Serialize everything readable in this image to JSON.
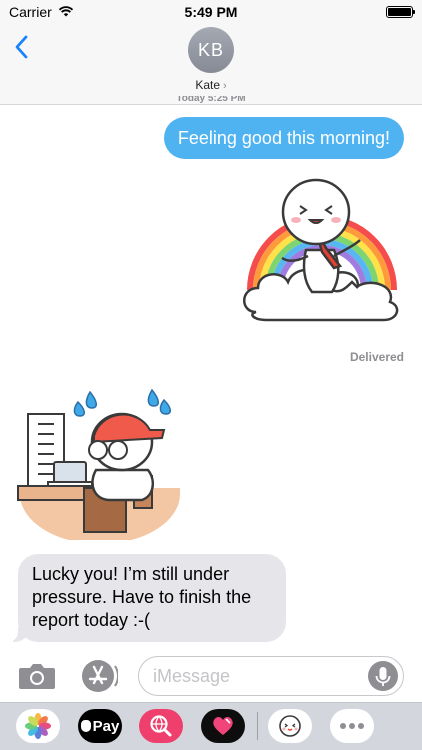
{
  "status_bar": {
    "carrier": "Carrier",
    "time": "5:49 PM"
  },
  "header": {
    "avatar_initials": "KB",
    "contact_name": "Kate",
    "back_icon": "chevron-left-icon"
  },
  "conversation": {
    "timestamp_peek": "Today 5:25 PM",
    "outgoing_message": "Feeling good this morning!",
    "delivery_status": "Delivered",
    "incoming_message": "Lucky you! I’m still under pressure. Have to finish the report today :-("
  },
  "input_bar": {
    "placeholder": "iMessage",
    "value": ""
  },
  "app_drawer": {
    "apple_pay_label": "Pay",
    "items": [
      "photos-icon",
      "apple-pay-icon",
      "image-search-icon",
      "digital-touch-heart-icon",
      "sticker-pack-icon",
      "more-apps-icon"
    ]
  },
  "colors": {
    "outgoing_bubble": "#4fb3f2",
    "incoming_bubble": "#e6e6ea",
    "ios_blue": "#1a82fb",
    "drawer_bg": "#d3d6dc"
  }
}
